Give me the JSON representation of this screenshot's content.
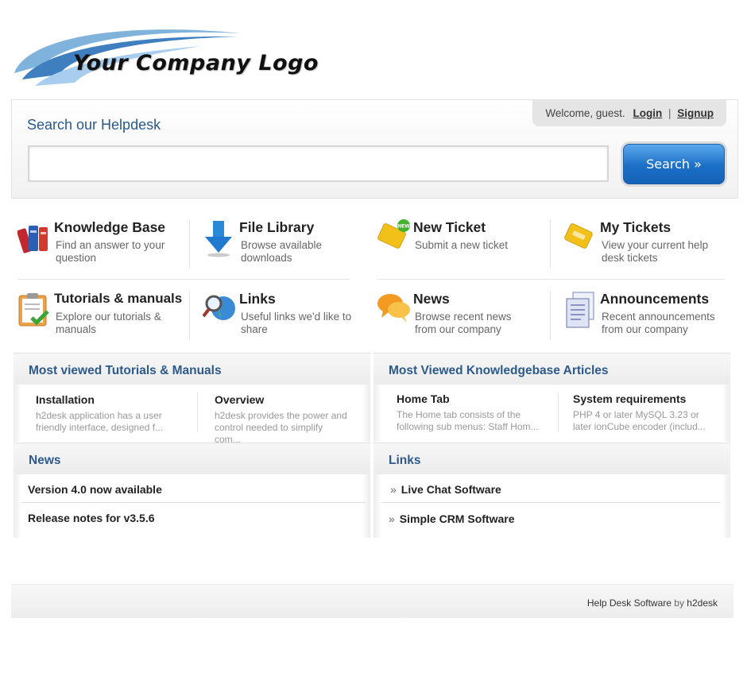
{
  "logo": {
    "text": "Your Company Logo"
  },
  "header": {
    "search_title": "Search our Helpdesk",
    "welcome": "Welcome, guest.",
    "login": "Login",
    "separator": "|",
    "signup": "Signup",
    "search_button": "Search »",
    "search_value": "",
    "search_placeholder": ""
  },
  "features": [
    {
      "title": "Knowledge Base",
      "desc": "Find an answer to your question",
      "icon": "books-icon"
    },
    {
      "title": "File Library",
      "desc": "Browse available downloads",
      "icon": "download-arrow-icon"
    },
    {
      "title": "New Ticket",
      "desc": "Submit a new ticket",
      "icon": "new-ticket-icon",
      "badge": "NEW"
    },
    {
      "title": "My Tickets",
      "desc": "View your current help desk tickets",
      "icon": "ticket-icon"
    },
    {
      "title": "Tutorials & manuals",
      "desc": "Explore our tutorials & manuals",
      "icon": "clipboard-check-icon"
    },
    {
      "title": "Links",
      "desc": "Useful links we'd like to share",
      "icon": "globe-magnifier-icon"
    },
    {
      "title": "News",
      "desc": "Browse recent news from our company",
      "icon": "speech-bubbles-icon"
    },
    {
      "title": "Announcements",
      "desc": "Recent announcements from our company",
      "icon": "documents-icon"
    }
  ],
  "tutorials_panel": {
    "title": "Most viewed Tutorials & Manuals",
    "items": [
      {
        "title": "Installation",
        "desc": "h2desk application has a user friendly interface, designed f..."
      },
      {
        "title": "Overview",
        "desc": "h2desk provides the power and control needed to simplify com..."
      }
    ]
  },
  "kb_panel": {
    "title": "Most Viewed Knowledgebase Articles",
    "items": [
      {
        "title": "Home Tab",
        "desc": "The Home tab consists of the following sub menus: Staff Hom..."
      },
      {
        "title": "System requirements",
        "desc": "PHP 4 or later MySQL 3.23 or later ionCube encoder (includ..."
      }
    ]
  },
  "news_panel": {
    "title": "News",
    "items": [
      "Version 4.0 now available",
      "Release notes for v3.5.6"
    ]
  },
  "links_panel": {
    "title": "Links",
    "bullet": "»",
    "items": [
      "Live Chat Software",
      "Simple CRM Software"
    ]
  },
  "footer": {
    "product": "Help Desk Software",
    "by": "by",
    "brand": "h2desk"
  },
  "colors": {
    "accent": "#2d5a8a",
    "button": "#1c6fc7",
    "panel_bg": "#f1f1f1"
  }
}
